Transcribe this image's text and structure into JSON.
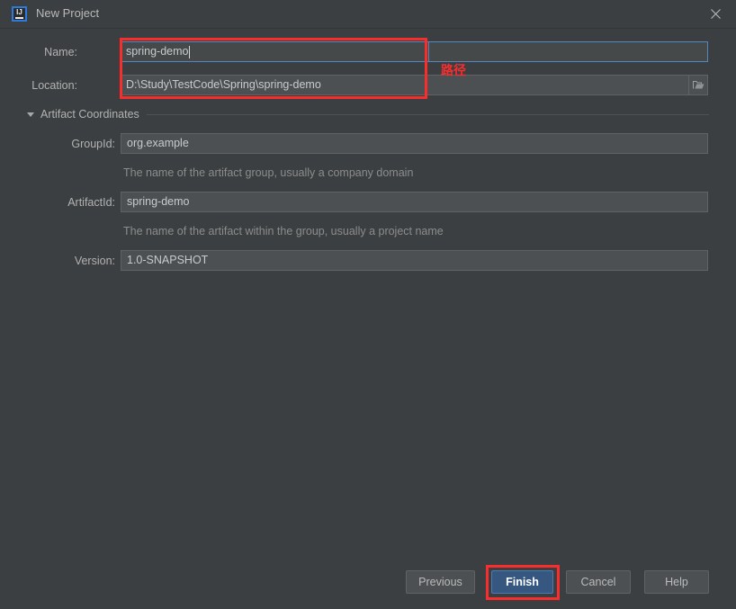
{
  "window": {
    "title": "New Project",
    "app_icon": "intellij-idea-logo",
    "close_icon": "close-icon"
  },
  "form": {
    "name": {
      "label": "Name:",
      "value": "spring-demo",
      "focused": true
    },
    "location": {
      "label": "Location:",
      "value": "D:\\Study\\TestCode\\Spring\\spring-demo",
      "browse_icon": "folder-open-icon"
    }
  },
  "artifact_section": {
    "title": "Artifact Coordinates",
    "expanded": true,
    "toggle_icon": "chevron-down-icon",
    "fields": [
      {
        "label": "GroupId:",
        "value": "org.example",
        "hint": "The name of the artifact group, usually a company domain"
      },
      {
        "label": "ArtifactId:",
        "value": "spring-demo",
        "hint": "The name of the artifact within the group, usually a project name"
      },
      {
        "label": "Version:",
        "value": "1.0-SNAPSHOT",
        "hint": ""
      }
    ]
  },
  "buttons": {
    "previous": "Previous",
    "finish": "Finish",
    "cancel": "Cancel",
    "help": "Help"
  },
  "annotations": {
    "path_label": "路径"
  },
  "colors": {
    "dialog_bg": "#3c3f41",
    "field_bg": "#4c5052",
    "focus_border": "#5486bf",
    "primary_button": "#365880",
    "annotation_red": "#fa2d2d"
  }
}
